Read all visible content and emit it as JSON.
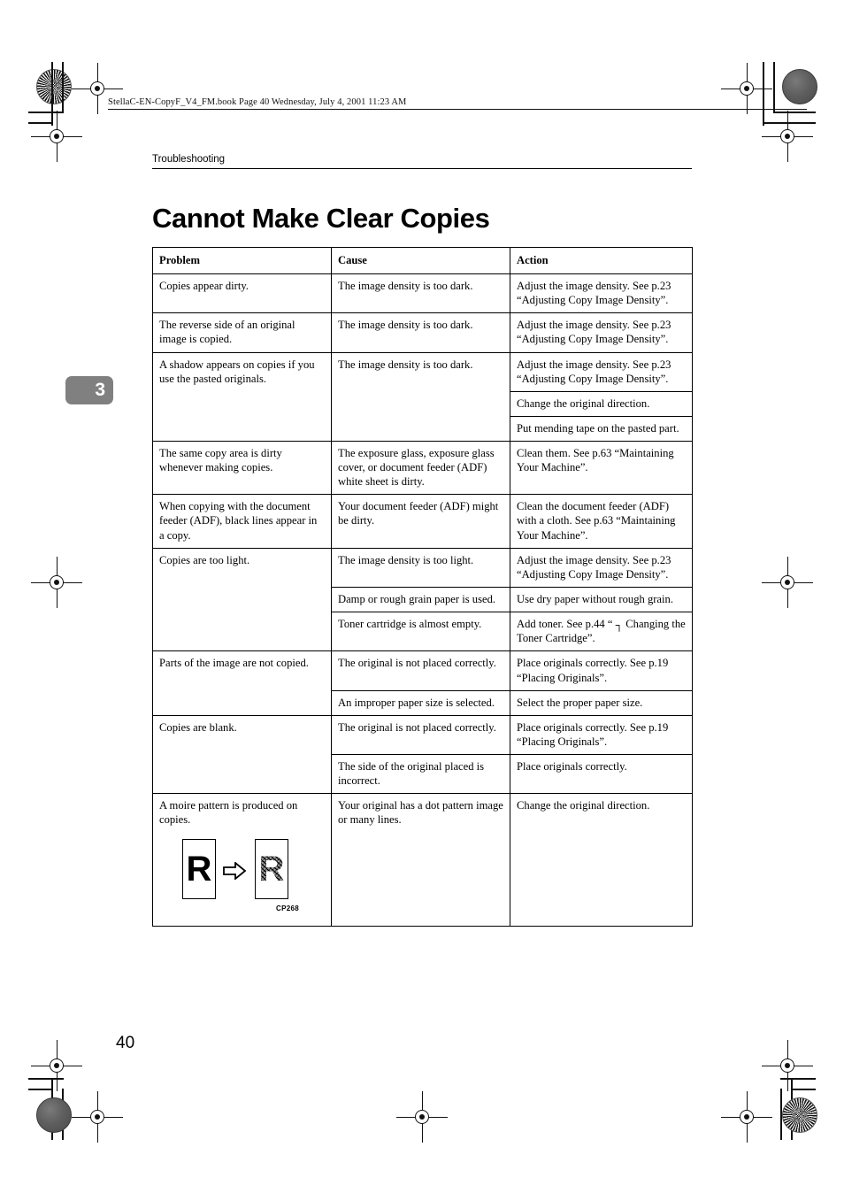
{
  "print_header": "StellaC-EN-CopyF_V4_FM.book  Page 40  Wednesday, July 4, 2001  11:23 AM",
  "running_head": "Troubleshooting",
  "chapter_title": "Cannot Make Clear Copies",
  "chapter_tab": "3",
  "page_number": "40",
  "figure": {
    "code": "CP268",
    "original_letter": "R",
    "copy_letter": "R",
    "arrow": "right-arrow-icon"
  },
  "colors": {
    "chapter_tab_bg": "#808080",
    "chapter_tab_text": "#ffffff",
    "rule": "#000000",
    "text": "#000000"
  },
  "table": {
    "headers": [
      "Problem",
      "Cause",
      "Action"
    ],
    "rows": [
      {
        "problem": "Copies appear dirty.",
        "causes": [
          {
            "cause": "The image density is too dark.",
            "actions": [
              "Adjust the image density. See p.23 “Adjusting Copy Image Density”."
            ]
          }
        ]
      },
      {
        "problem": "The reverse side of an original image is copied.",
        "causes": [
          {
            "cause": "The image density is too dark.",
            "actions": [
              "Adjust the image density. See p.23 “Adjusting Copy Image Density”."
            ]
          }
        ]
      },
      {
        "problem": "A shadow appears on copies if you use the pasted originals.",
        "causes": [
          {
            "cause": "The image density is too dark.",
            "actions": [
              "Adjust the image density. See p.23 “Adjusting Copy Image Density”.",
              "Change the original direction.",
              "Put mending tape on the pasted part."
            ]
          }
        ]
      },
      {
        "problem": "The same copy area is dirty whenever making copies.",
        "causes": [
          {
            "cause": "The exposure glass, exposure glass cover, or document feeder (ADF) white sheet is dirty.",
            "actions": [
              "Clean them. See p.63 “Maintaining Your Machine”."
            ]
          }
        ]
      },
      {
        "problem": "When copying with the document feeder (ADF), black lines appear in a copy.",
        "causes": [
          {
            "cause": "Your document feeder (ADF) might be dirty.",
            "actions": [
              "Clean the document feeder (ADF) with a cloth. See p.63 “Maintaining Your Machine”."
            ]
          }
        ]
      },
      {
        "problem": "Copies are too light.",
        "causes": [
          {
            "cause": "The image density is too light.",
            "actions": [
              "Adjust the image density. See p.23 “Adjusting Copy Image Density”."
            ]
          },
          {
            "cause": "Damp or rough grain paper is used.",
            "actions": [
              "Use dry paper without rough grain."
            ]
          },
          {
            "cause": "Toner cartridge is almost empty.",
            "actions": [
              "Add toner. See p.44 “ ┐ Changing the Toner Cartridge”."
            ]
          }
        ]
      },
      {
        "problem": "Parts of the image are not copied.",
        "causes": [
          {
            "cause": "The original is not placed correctly.",
            "actions": [
              "Place originals correctly. See p.19 “Placing Originals”."
            ]
          },
          {
            "cause": "An improper paper size is selected.",
            "actions": [
              "Select the proper paper size."
            ]
          }
        ]
      },
      {
        "problem": "Copies are blank.",
        "causes": [
          {
            "cause": "The original is not placed correctly.",
            "actions": [
              "Place originals correctly. See p.19 “Placing Originals”."
            ]
          },
          {
            "cause": "The side of the original placed is incorrect.",
            "actions": [
              "Place originals correctly."
            ]
          }
        ]
      },
      {
        "problem": "A moire pattern is produced on copies.",
        "has_figure": true,
        "causes": [
          {
            "cause": "Your original has a dot pattern image or many lines.",
            "actions": [
              "Change the original direction."
            ]
          }
        ]
      }
    ]
  }
}
